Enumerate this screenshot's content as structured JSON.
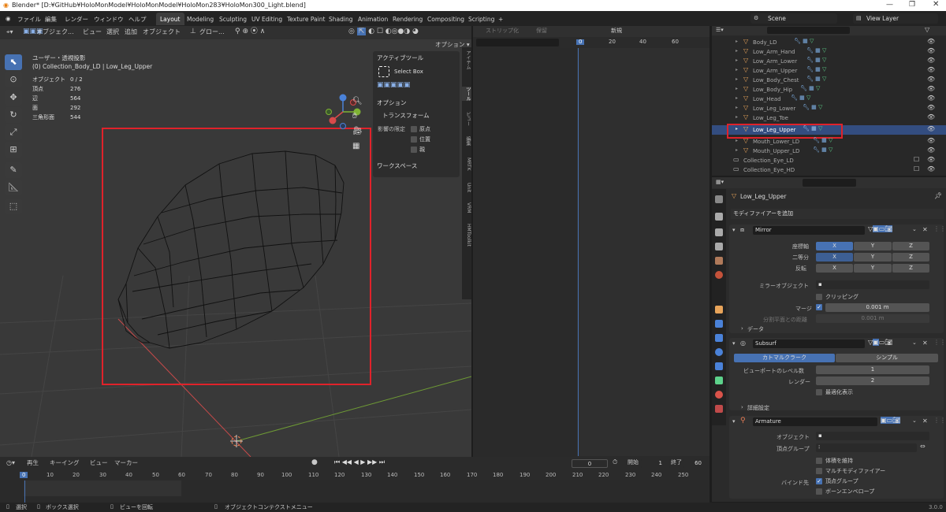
{
  "title": "Blender* [D:¥GitHub¥HoloMonModel¥HoloMonModel¥HoloMon283¥HoloMon300_Light.blend]",
  "menu": [
    "ファイル",
    "編集",
    "レンダー",
    "ウィンドウ",
    "ヘルプ"
  ],
  "workspaces": [
    "Layout",
    "Modeling",
    "Sculpting",
    "UV Editing",
    "Texture Paint",
    "Shading",
    "Animation",
    "Rendering",
    "Compositing",
    "Scripting",
    "+"
  ],
  "scene": "Scene",
  "view_layer": "View Layer",
  "viewport": {
    "mode": "オブジェク...",
    "menus": [
      "ビュー",
      "選択",
      "追加",
      "オブジェクト"
    ],
    "transform": "グロー...",
    "options": "オプション ▾",
    "view_name": "ユーザー・透視投影",
    "collection": "(0) Collection_Body_LD | Low_Leg_Upper",
    "stats": [
      {
        "label": "オブジェクト",
        "value": "0 / 2"
      },
      {
        "label": "頂点",
        "value": "276"
      },
      {
        "label": "辺",
        "value": "564"
      },
      {
        "label": "面",
        "value": "292"
      },
      {
        "label": "三角形面",
        "value": "544"
      }
    ]
  },
  "npanel": {
    "active_tool_header": "アクティブツール",
    "select_box": "Select Box",
    "options_header": "オプション",
    "transform_header": "トランスフォーム",
    "affect_only": "影響の限定",
    "affect_items": [
      "原点",
      "位置",
      "親"
    ],
    "workspace_header": "ワークスペース",
    "tabs": [
      "アイテム",
      "ツール",
      "ビュー",
      "編集",
      "MRTK",
      "Unit",
      "VRM",
      "HMToolkit"
    ]
  },
  "dopesheet": {
    "header_items": [
      "ストリップ化",
      "保留",
      "新規"
    ],
    "frames": [
      "0",
      "20",
      "40",
      "60"
    ]
  },
  "outliner": {
    "items": [
      {
        "name": "Body_LD",
        "selected": false
      },
      {
        "name": "Low_Arm_Hand",
        "selected": false
      },
      {
        "name": "Low_Arm_Lower",
        "selected": false
      },
      {
        "name": "Low_Arm_Upper",
        "selected": false
      },
      {
        "name": "Low_Body_Chest",
        "selected": false
      },
      {
        "name": "Low_Body_Hip",
        "selected": false
      },
      {
        "name": "Low_Head",
        "selected": false
      },
      {
        "name": "Low_Leg_Lower",
        "selected": false
      },
      {
        "name": "Low_Leg_Toe",
        "selected": false
      },
      {
        "name": "Low_Leg_Upper",
        "selected": true
      },
      {
        "name": "Mouth_Lower_LD",
        "selected": false
      },
      {
        "name": "Mouth_Upper_LD",
        "selected": false
      }
    ],
    "collections": [
      "Collection_Eye_LD",
      "Collection_Eye_HD"
    ]
  },
  "properties": {
    "object_name": "Low_Leg_Upper",
    "add_modifier": "モディファイアーを追加",
    "mirror": {
      "name": "Mirror",
      "axis_label": "座標軸",
      "bisect_label": "二等分",
      "flip_label": "反転",
      "xyz": [
        "X",
        "Y",
        "Z"
      ],
      "mirror_object": "ミラーオブジェクト",
      "clipping": "クリッピング",
      "merge": "マージ",
      "merge_value": "0.001 m",
      "bisect_dist": "分割平面との距離",
      "bisect_value": "0.001 m",
      "data": "データ"
    },
    "subsurf": {
      "name": "Subsurf",
      "catmull": "カトマルクラーク",
      "simple": "シンプル",
      "viewport_levels": "ビューポートのレベル数",
      "viewport_value": "1",
      "render": "レンダー",
      "render_value": "2",
      "optimal": "最適化表示",
      "advanced": "詳細設定"
    },
    "armature": {
      "name": "Armature",
      "object": "オブジェクト",
      "vertex_group": "頂点グループ",
      "preserve_volume": "体積を維持",
      "multi_modifier": "マルチモディファイアー",
      "bind_to": "バインド先",
      "vertex_groups_bind": "頂点グループ",
      "bone_envelopes": "ボーンエンベロープ"
    }
  },
  "timeline": {
    "menus": [
      "再生",
      "キーイング",
      "ビュー",
      "マーカー"
    ],
    "current": "0",
    "start_label": "開始",
    "start": "1",
    "end_label": "終了",
    "end": "60",
    "ticks": [
      "0",
      "10",
      "20",
      "30",
      "40",
      "50",
      "60",
      "70",
      "80",
      "90",
      "100",
      "110",
      "120",
      "130",
      "140",
      "150",
      "160",
      "170",
      "180",
      "190",
      "200",
      "210",
      "220",
      "230",
      "240",
      "250"
    ]
  },
  "status": {
    "select": "選択",
    "box_select": "ボックス選択",
    "rotate_view": "ビューを回転",
    "context_menu": "オブジェクトコンテクストメニュー",
    "version": "3.0.0"
  },
  "colors": {
    "accent": "#4772b3",
    "highlight_box": "#e0222a",
    "x_axis": "#d94a4a",
    "y_axis": "#7fb234",
    "z_axis": "#4a82d9"
  }
}
